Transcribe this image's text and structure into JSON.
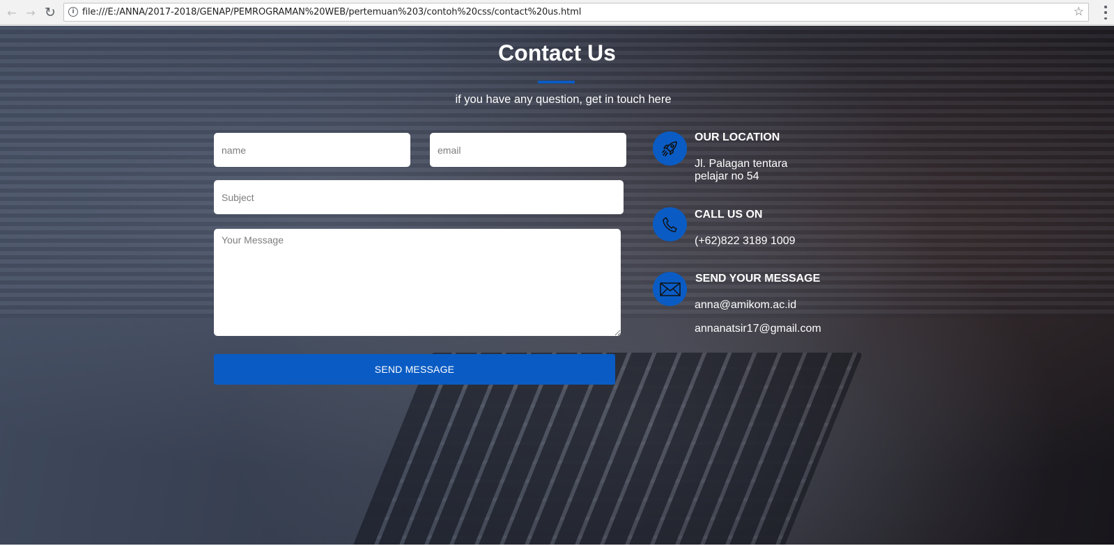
{
  "browser": {
    "back_icon": "back-arrow-icon",
    "forward_icon": "forward-arrow-icon",
    "reload_icon": "reload-icon",
    "info_icon": "info-icon",
    "url": "file:///E:/ANNA/2017-2018/GENAP/PEMROGRAMAN%20WEB/pertemuan%203/contoh%20css/contact%20us.html",
    "star_icon": "bookmark-star-icon",
    "menu_icon": "kebab-menu-icon"
  },
  "page": {
    "title": "Contact Us",
    "subtitle": "if you have any question, get in touch here",
    "accent_color": "#0a5cc4"
  },
  "form": {
    "name_placeholder": "name",
    "email_placeholder": "email",
    "subject_placeholder": "Subject",
    "message_placeholder": "Your Message",
    "send_label": "SEND MESSAGE"
  },
  "contact_info": {
    "location": {
      "icon": "rocket-icon",
      "heading": "OUR LOCATION",
      "address_line1": "Jl. Palagan tentara",
      "address_line2": "pelajar no 54"
    },
    "phone": {
      "icon": "phone-icon",
      "heading": "CALL US ON",
      "number": "(+62)822 3189 1009"
    },
    "message": {
      "icon": "envelope-icon",
      "heading": "SEND YOUR MESSAGE",
      "email1": "anna@amikom.ac.id",
      "email2": "annanatsir17@gmail.com"
    }
  }
}
